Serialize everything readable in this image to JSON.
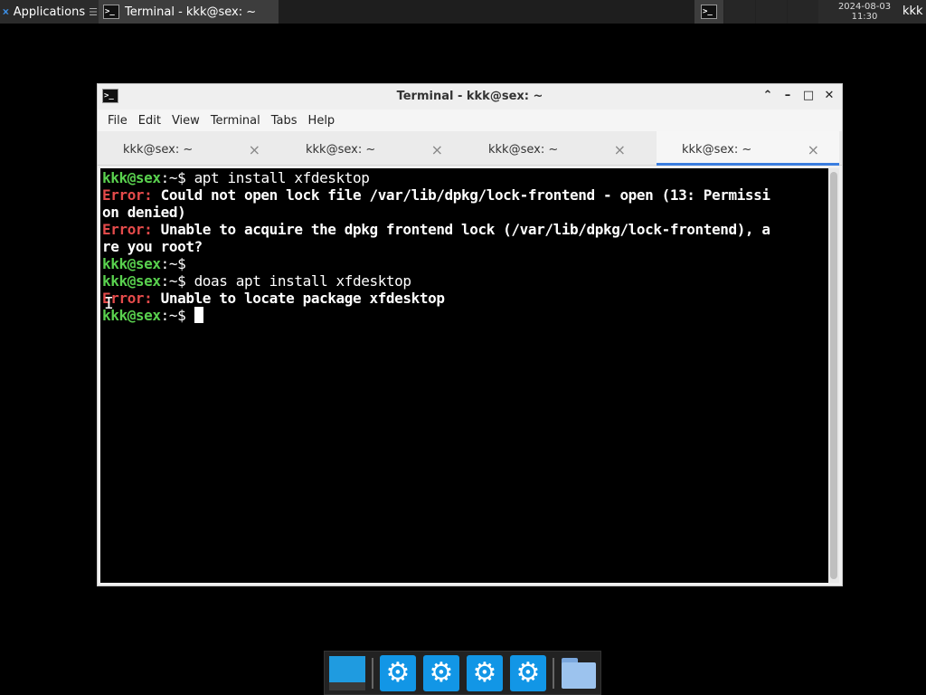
{
  "panel": {
    "applications_label": "Applications",
    "applications_glyph": "☰",
    "task_title": "Terminal - kkk@sex: ~",
    "clock_date": "2024-08-03",
    "clock_time": "11:30",
    "user": "kkk"
  },
  "window": {
    "title": "Terminal - kkk@sex: ~",
    "buttons": {
      "up": "⌃",
      "minimize": "–",
      "maximize": "□",
      "close": "✕"
    }
  },
  "menu": {
    "file": "File",
    "edit": "Edit",
    "view": "View",
    "terminal": "Terminal",
    "tabs": "Tabs",
    "help": "Help"
  },
  "tabs": [
    {
      "label": "kkk@sex: ~",
      "close": "×",
      "active": false
    },
    {
      "label": "kkk@sex: ~",
      "close": "×",
      "active": false
    },
    {
      "label": "kkk@sex: ~",
      "close": "×",
      "active": false
    },
    {
      "label": "kkk@sex: ~",
      "close": "×",
      "active": true
    }
  ],
  "terminal": {
    "prompt_user": "kkk@sex",
    "prompt_suffix": ":~$ ",
    "cmd1": "apt install xfdesktop",
    "err_label": "Error:",
    "err1_a": " Could not open lock file /var/lib/dpkg/lock-frontend - open (13: Permissi",
    "err1_b": "on denied)",
    "err2_a": " Unable to acquire the dpkg frontend lock (/var/lib/dpkg/lock-frontend), a",
    "err2_b": "re you root?",
    "cmd2": "doas apt install xfdesktop",
    "err3": " Unable to locate package xfdesktop"
  },
  "dock": {
    "items": [
      "show-desktop",
      "settings",
      "settings",
      "settings",
      "settings",
      "file-manager"
    ]
  },
  "colors": {
    "prompt_green": "#59d14e",
    "error_red": "#e54b4b",
    "tab_accent": "#3b7ee0",
    "dock_blue": "#1296e6"
  }
}
